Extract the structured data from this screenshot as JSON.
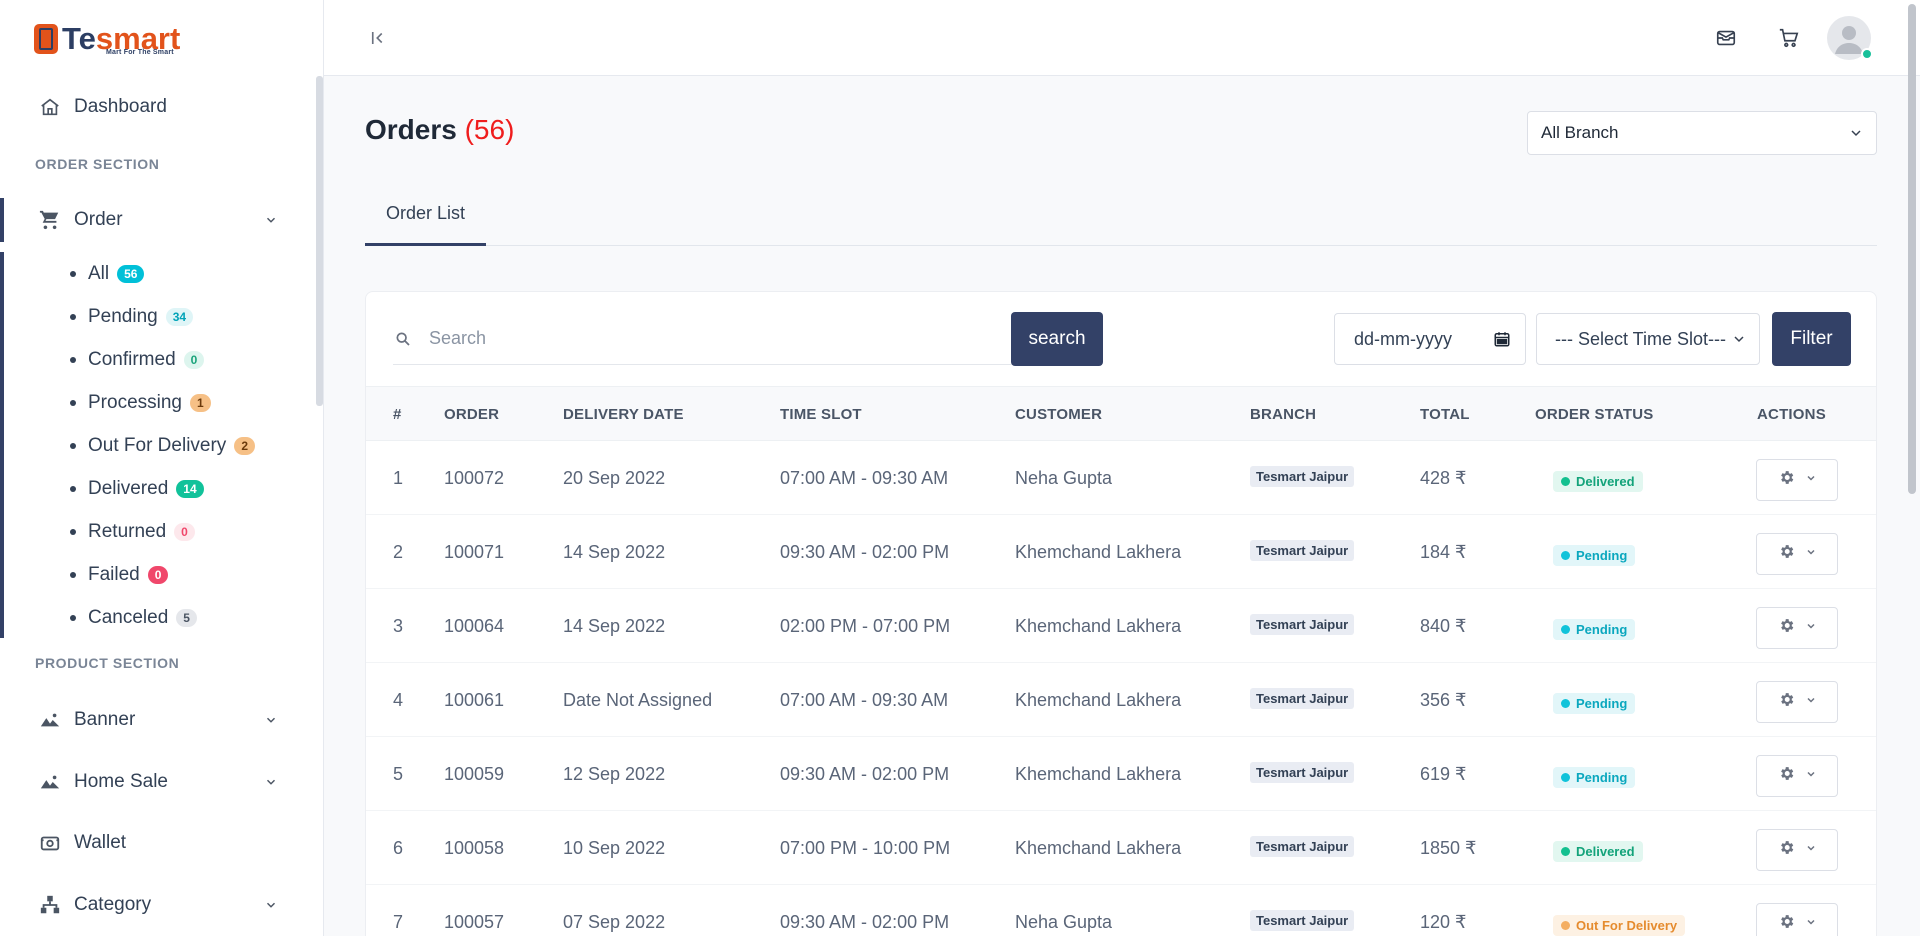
{
  "brand": {
    "name_part1": "Te",
    "name_part2": "smart",
    "tagline": "Mart For The Smart"
  },
  "sidebar": {
    "dashboard": "Dashboard",
    "order_section": "ORDER SECTION",
    "order": "Order",
    "order_items": [
      {
        "label": "All",
        "count": "56"
      },
      {
        "label": "Pending",
        "count": "34"
      },
      {
        "label": "Confirmed",
        "count": "0"
      },
      {
        "label": "Processing",
        "count": "1"
      },
      {
        "label": "Out For Delivery",
        "count": "2"
      },
      {
        "label": "Delivered",
        "count": "14"
      },
      {
        "label": "Returned",
        "count": "0"
      },
      {
        "label": "Failed",
        "count": "0"
      },
      {
        "label": "Canceled",
        "count": "5"
      }
    ],
    "product_section": "PRODUCT SECTION",
    "banner": "Banner",
    "home_sale": "Home Sale",
    "wallet": "Wallet",
    "category": "Category"
  },
  "page": {
    "title": "Orders",
    "count": "(56)"
  },
  "branch_select": "All Branch",
  "tabs": [
    "Order List"
  ],
  "search": {
    "placeholder": "Search",
    "button": "search"
  },
  "date_filter": "dd-mm-yyyy",
  "slot_select": "--- Select Time Slot---",
  "filter_button": "Filter",
  "columns": [
    "#",
    "ORDER",
    "DELIVERY DATE",
    "TIME SLOT",
    "CUSTOMER",
    "BRANCH",
    "TOTAL",
    "ORDER STATUS",
    "ACTIONS"
  ],
  "rows": [
    {
      "n": "1",
      "order": "100072",
      "date": "20 Sep 2022",
      "slot": "07:00 AM - 09:30 AM",
      "customer": "Neha Gupta",
      "branch": "Tesmart Jaipur",
      "total": "428 ₹",
      "status": "Delivered"
    },
    {
      "n": "2",
      "order": "100071",
      "date": "14 Sep 2022",
      "slot": "09:30 AM - 02:00 PM",
      "customer": "Khemchand Lakhera",
      "branch": "Tesmart Jaipur",
      "total": "184 ₹",
      "status": "Pending"
    },
    {
      "n": "3",
      "order": "100064",
      "date": "14 Sep 2022",
      "slot": "02:00 PM - 07:00 PM",
      "customer": "Khemchand Lakhera",
      "branch": "Tesmart Jaipur",
      "total": "840 ₹",
      "status": "Pending"
    },
    {
      "n": "4",
      "order": "100061",
      "date": "Date Not Assigned",
      "slot": "07:00 AM - 09:30 AM",
      "customer": "Khemchand Lakhera",
      "branch": "Tesmart Jaipur",
      "total": "356 ₹",
      "status": "Pending"
    },
    {
      "n": "5",
      "order": "100059",
      "date": "12 Sep 2022",
      "slot": "09:30 AM - 02:00 PM",
      "customer": "Khemchand Lakhera",
      "branch": "Tesmart Jaipur",
      "total": "619 ₹",
      "status": "Pending"
    },
    {
      "n": "6",
      "order": "100058",
      "date": "10 Sep 2022",
      "slot": "07:00 PM - 10:00 PM",
      "customer": "Khemchand Lakhera",
      "branch": "Tesmart Jaipur",
      "total": "1850 ₹",
      "status": "Delivered"
    },
    {
      "n": "7",
      "order": "100057",
      "date": "07 Sep 2022",
      "slot": "09:30 AM - 02:00 PM",
      "customer": "Neha Gupta",
      "branch": "Tesmart Jaipur",
      "total": "120 ₹",
      "status": "Out For Delivery"
    }
  ],
  "colors": {
    "primary": "#334167",
    "accent": "#e2531b",
    "count_red": "#ef1d1d"
  }
}
